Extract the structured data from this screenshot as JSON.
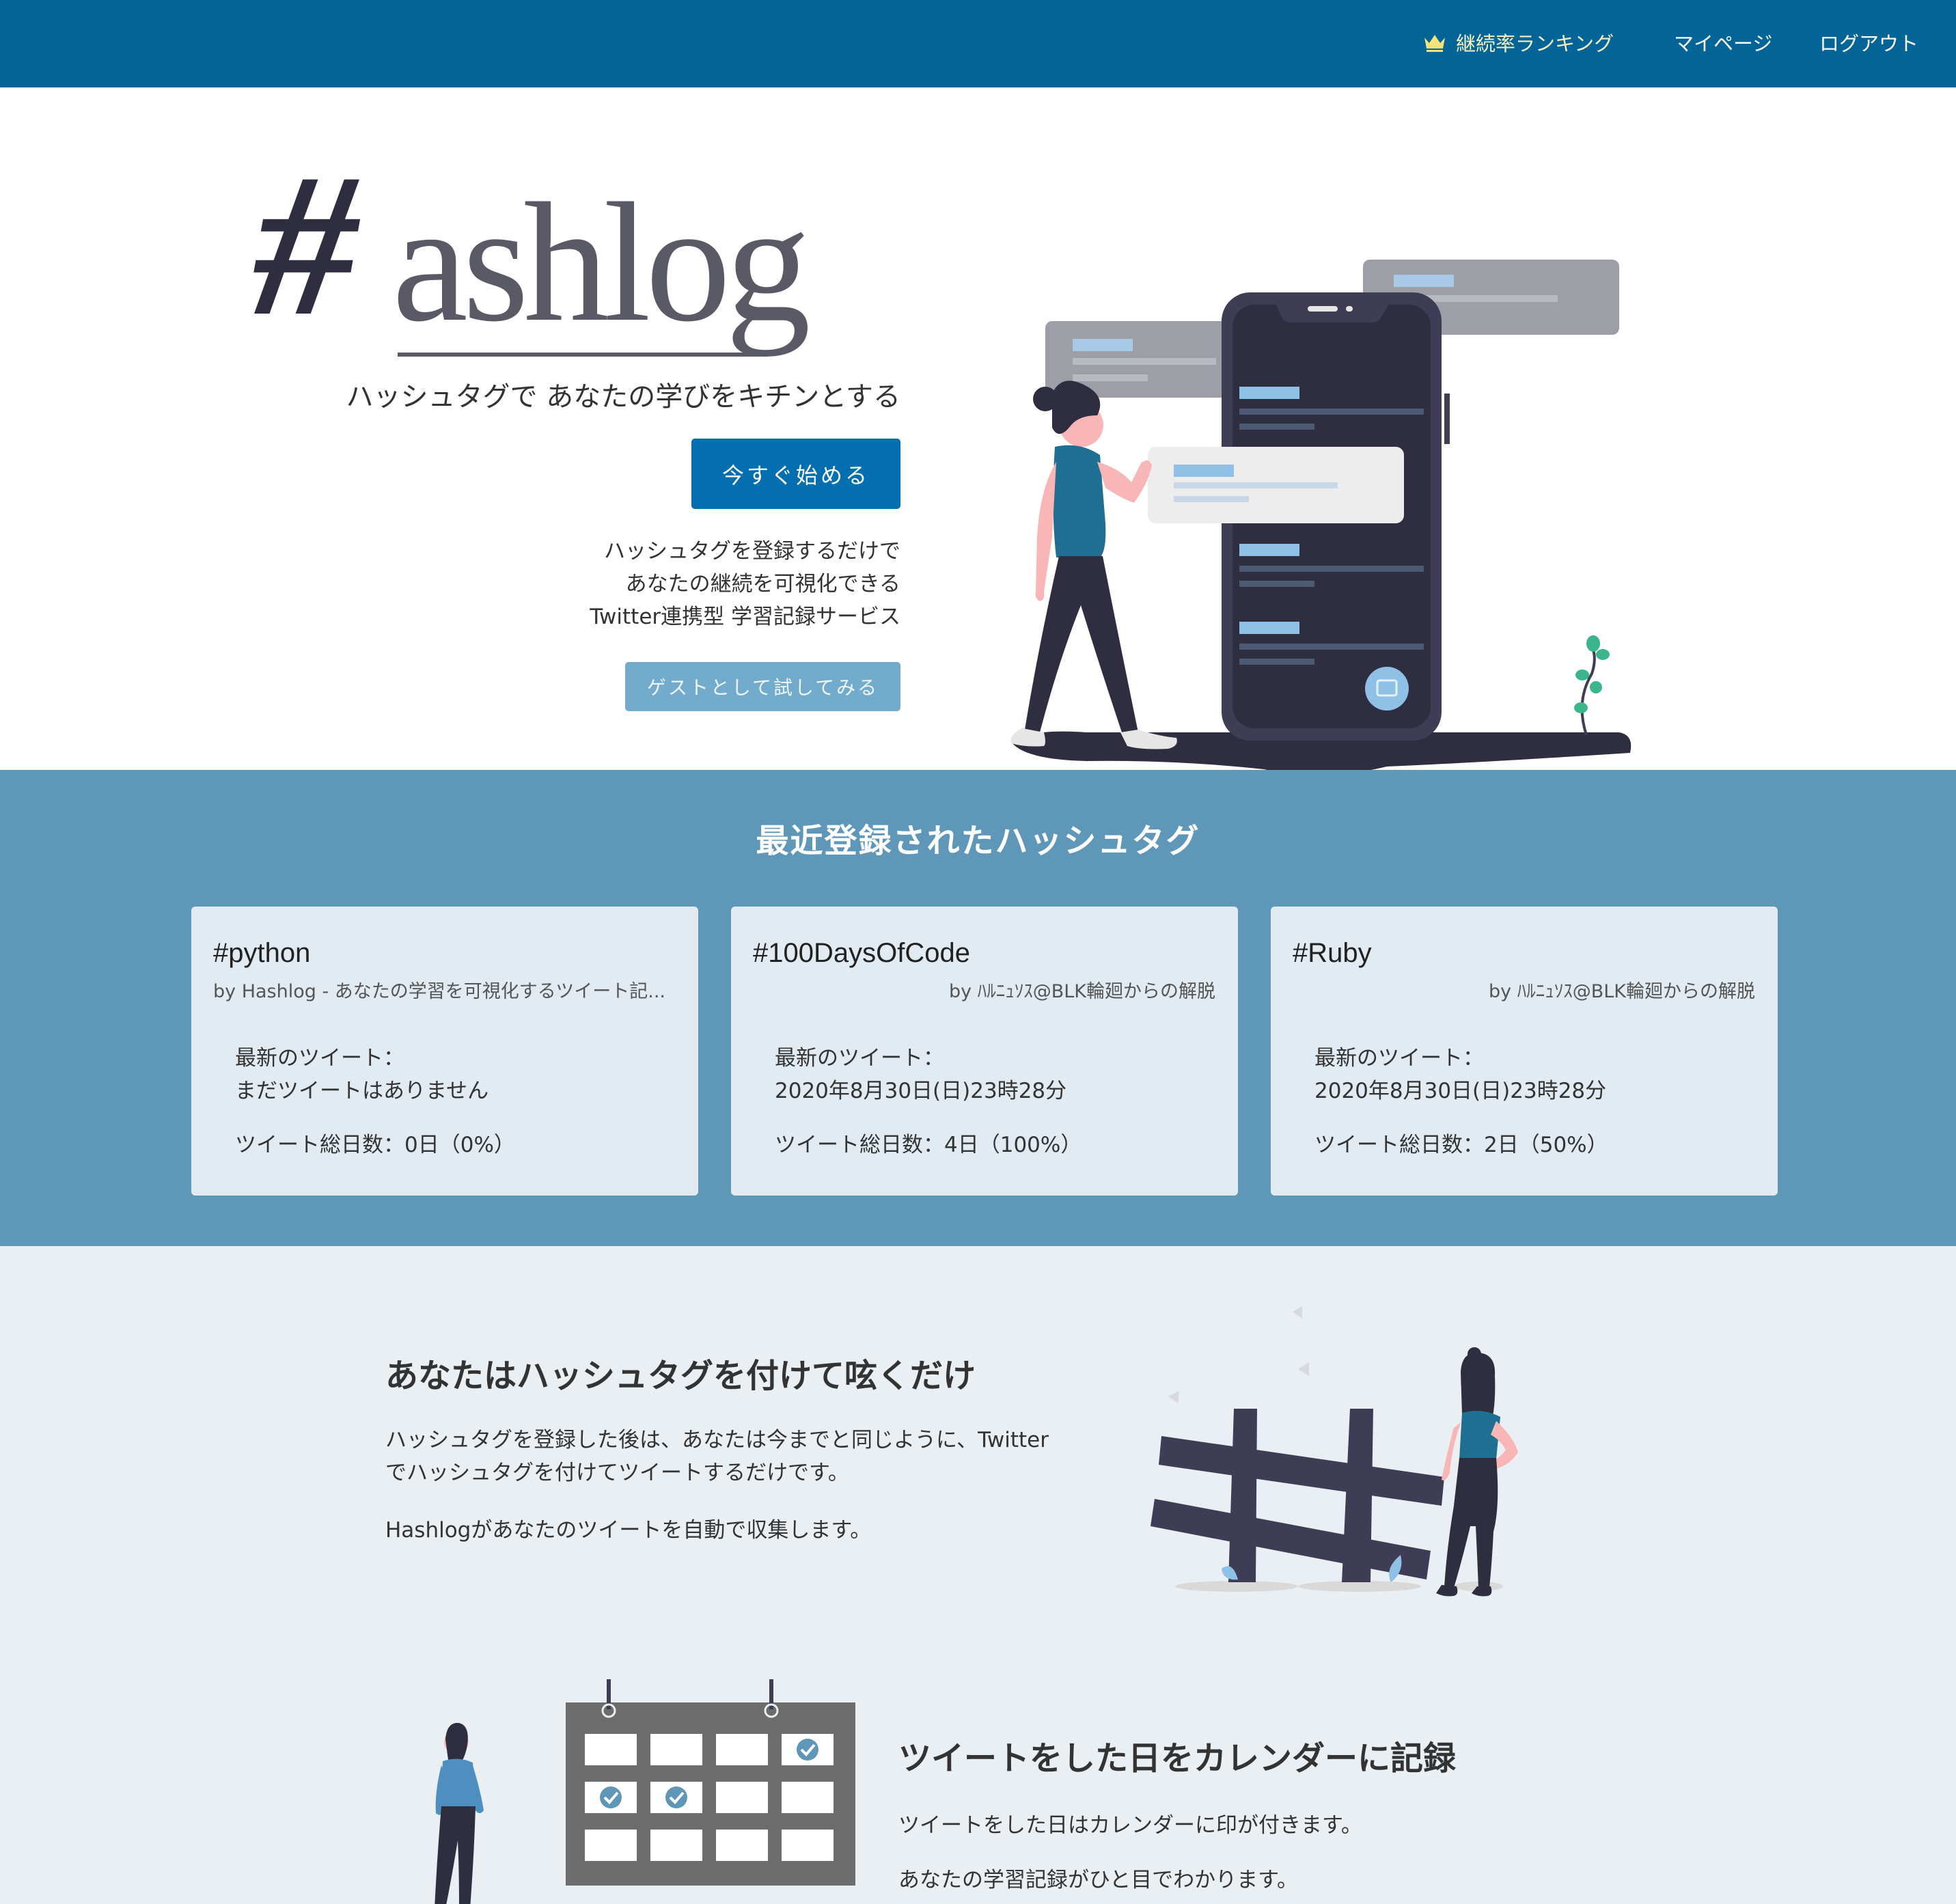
{
  "navbar": {
    "ranking_label": "継続率ランキング",
    "mypage_label": "マイページ",
    "logout_label": "ログアウト"
  },
  "hero": {
    "logo_hash": "#",
    "logo_word": "ashlog",
    "tagline": "ハッシュタグで あなたの学びをキチンとする",
    "start_button": "今すぐ始める",
    "desc_line1": "ハッシュタグを登録するだけで",
    "desc_line2": "あなたの継続を可視化できる",
    "desc_line3": "Twitter連携型 学習記録サービス",
    "guest_button": "ゲストとして試してみる"
  },
  "recent": {
    "title": "最近登録されたハッシュタグ",
    "cards": [
      {
        "tag": "#python",
        "by": "by Hashlog - あなたの学習を可視化するツイート記...",
        "latest_label": "最新のツイート：",
        "latest_value": "まだツイートはありません",
        "total": "ツイート総日数：0日（0%）"
      },
      {
        "tag": "#100DaysOfCode",
        "by": "by ﾊﾙﾆｭｿｽ@BLK輪廻からの解脱",
        "latest_label": "最新のツイート：",
        "latest_value": "2020年8月30日(日)23時28分",
        "total": "ツイート総日数：4日（100%）"
      },
      {
        "tag": "#Ruby",
        "by": "by ﾊﾙﾆｭｿｽ@BLK輪廻からの解脱",
        "latest_label": "最新のツイート：",
        "latest_value": "2020年8月30日(日)23時28分",
        "total": "ツイート総日数：2日（50%）"
      }
    ]
  },
  "features": {
    "f1_title": "あなたはハッシュタグを付けて呟くだけ",
    "f1_p1": "ハッシュタグを登録した後は、あなたは今までと同じように、Twitterでハッシュタグを付けてツイートするだけです。",
    "f1_p2": "Hashlogがあなたのツイートを自動で収集します。",
    "f2_title": "ツイートをした日をカレンダーに記録",
    "f2_p1": "ツイートをした日はカレンダーに印が付きます。",
    "f2_p2": "あなたの学習記録がひと目でわかります。"
  },
  "colors": {
    "navbar": "#036597",
    "primary_button": "#036fb0",
    "guest_button": "#73abcd",
    "recent_bg": "#5f97b8",
    "card_bg": "#e1ebf1",
    "features_bg": "#e9eff3",
    "accent_teal": "#1f6f93",
    "dark_ink": "#2f2e41"
  },
  "icons": {
    "ranking": "crown-icon"
  }
}
